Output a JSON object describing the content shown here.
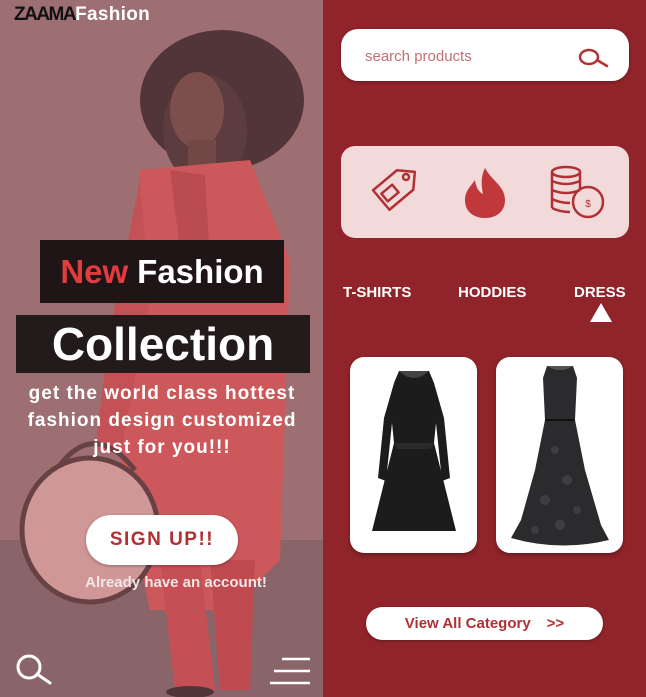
{
  "brand": {
    "logo_prefix": "ZAAMA",
    "logo_suffix": "Fashion"
  },
  "hero": {
    "headline_new": "New",
    "headline_fashion": "Fashion",
    "headline_collection": "Collection",
    "tagline": "get the world class hottest fashion design customized just for you!!!",
    "signup_label": "SIGN UP!!",
    "login_prompt": "Already have an account!"
  },
  "search": {
    "placeholder": "search products"
  },
  "quick_icons": [
    "price-tag-icon",
    "fire-icon",
    "coins-icon"
  ],
  "tabs": [
    "T-SHIRTS",
    "HODDIES",
    "DRESS"
  ],
  "active_tab": "DRESS",
  "products": [
    "black-lace-cocktail-dress",
    "black-lace-gown"
  ],
  "view_all": {
    "label": "View All Category",
    "arrows": ">>"
  },
  "colors": {
    "accent": "#90242a",
    "headline_red": "#e23c3f",
    "button_text": "#b03034",
    "icon_panel": "#f2d9da"
  }
}
